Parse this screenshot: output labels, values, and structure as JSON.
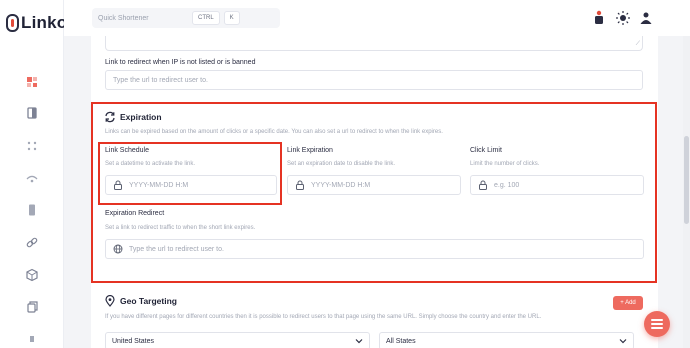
{
  "app": {
    "name": "Linko"
  },
  "topbar": {
    "search_placeholder": "Quick Shortener",
    "shortcut_keys": [
      "CTRL",
      "K"
    ]
  },
  "redirect_banned": {
    "label": "Link to redirect when IP is not listed or is banned",
    "placeholder": "Type the url to redirect user to."
  },
  "expiration": {
    "title": "Expiration",
    "description": "Links can be expired based on the amount of clicks or a specific date. You can also set a url to redirect to when the link expires.",
    "link_schedule": {
      "label": "Link Schedule",
      "help": "Set a datetime to activate the link.",
      "placeholder": "YYYY-MM-DD H:M"
    },
    "link_expiration": {
      "label": "Link Expiration",
      "help": "Set an expiration date to disable the link.",
      "placeholder": "YYYY-MM-DD H:M"
    },
    "click_limit": {
      "label": "Click Limit",
      "help": "Limit the number of clicks.",
      "placeholder": "e.g. 100"
    },
    "expiration_redirect": {
      "label": "Expiration Redirect",
      "help": "Set a link to redirect traffic to when the short link expires.",
      "placeholder": "Type the url to redirect user to."
    }
  },
  "geo_targeting": {
    "title": "Geo Targeting",
    "description": "If you have different pages for different countries then it is possible to redirect users to that page using the same URL. Simply choose the country and enter the URL.",
    "add_label": "+ Add",
    "country_value": "United States",
    "state_value": "All States"
  },
  "colors": {
    "accent": "#ee6a5f",
    "highlight": "#e53323"
  }
}
